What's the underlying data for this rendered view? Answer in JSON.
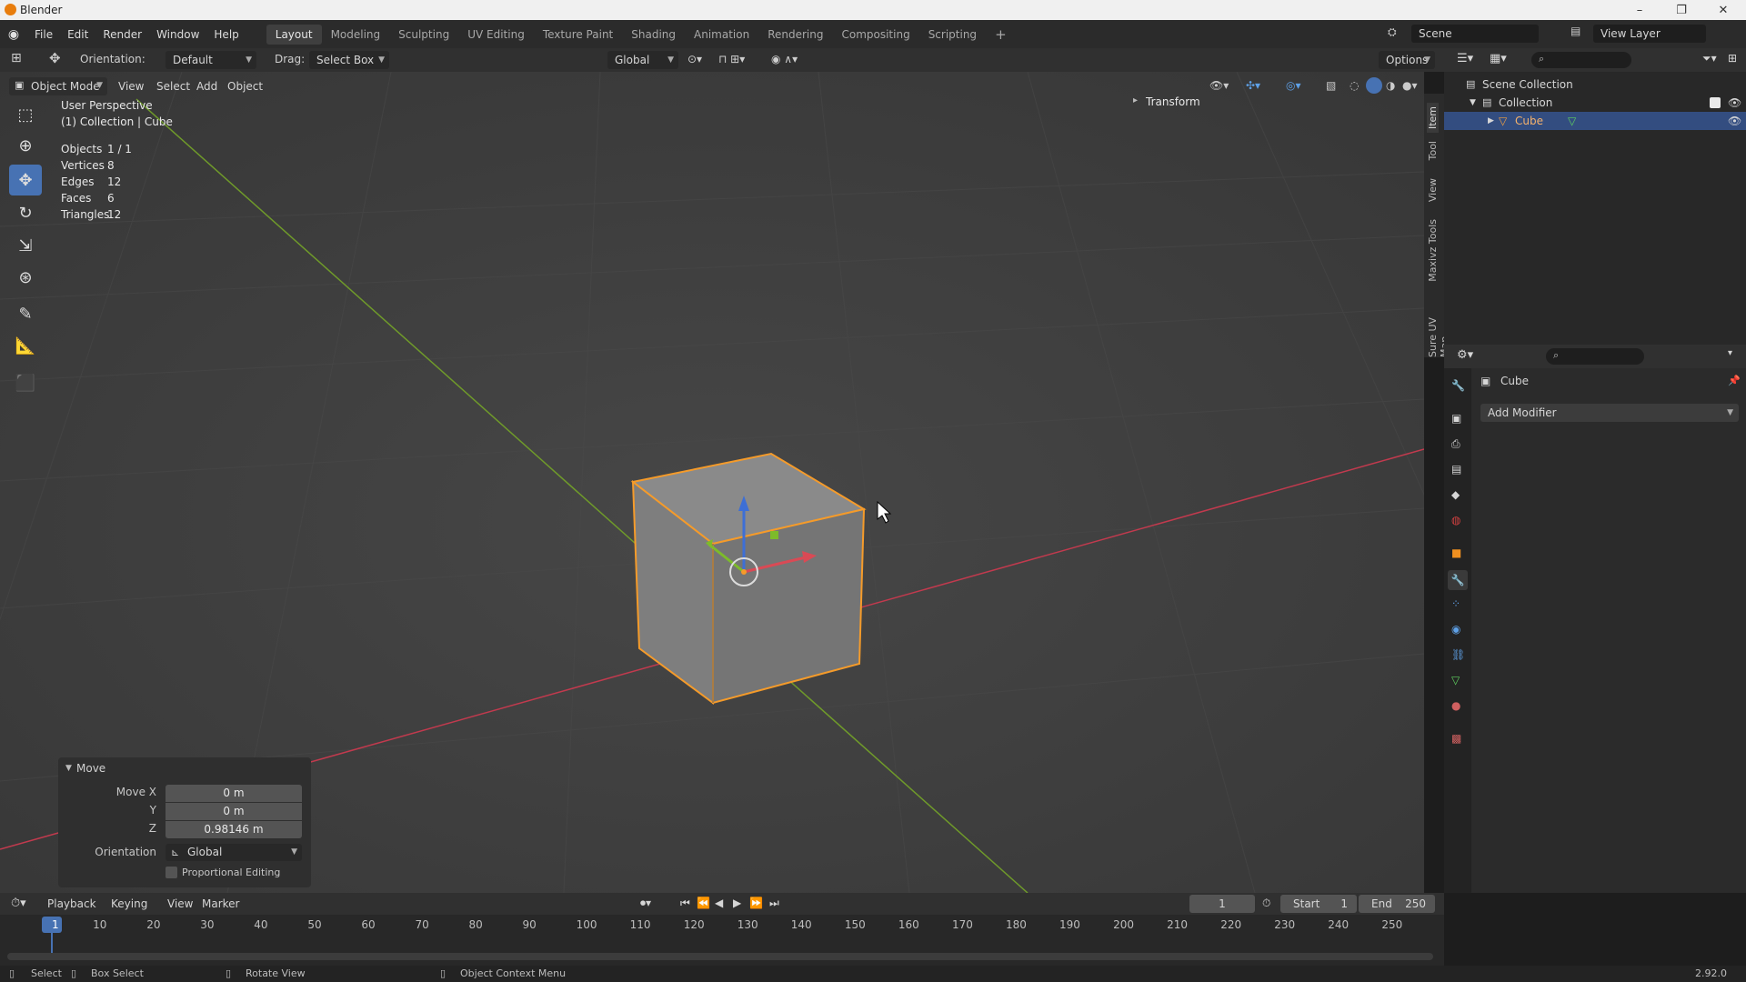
{
  "window": {
    "title": "Blender",
    "minimize": "–",
    "restore": "❐",
    "close": "✕"
  },
  "menu": {
    "items": [
      "File",
      "Edit",
      "Render",
      "Window",
      "Help"
    ]
  },
  "workspaces": [
    "Layout",
    "Modeling",
    "Sculpting",
    "UV Editing",
    "Texture Paint",
    "Shading",
    "Animation",
    "Rendering",
    "Compositing",
    "Scripting"
  ],
  "workspace_add": "+",
  "scene": {
    "label": "Scene",
    "view_layer": "View Layer"
  },
  "tool_header": {
    "orientation_label": "Orientation:",
    "orientation_value": "Default",
    "drag_label": "Drag:",
    "drag_value": "Select Box",
    "transform_orientation": "Global",
    "options": "Options"
  },
  "viewport_header": {
    "mode": "Object Mode",
    "menus": [
      "View",
      "Select",
      "Add",
      "Object"
    ]
  },
  "overlay": {
    "view_name": "User Perspective",
    "collection": "(1) Collection | Cube",
    "stats": [
      {
        "label": "Objects",
        "value": "1 / 1"
      },
      {
        "label": "Vertices",
        "value": "8"
      },
      {
        "label": "Edges",
        "value": "12"
      },
      {
        "label": "Faces",
        "value": "6"
      },
      {
        "label": "Triangles",
        "value": "12"
      }
    ]
  },
  "sidebar": {
    "transform_label": "Transform",
    "tabs": [
      "Item",
      "Tool",
      "View",
      "Maxivz Tools",
      "Sure UV Map"
    ]
  },
  "move_panel": {
    "title": "Move",
    "move_x_label": "Move X",
    "move_x": "0 m",
    "y_label": "Y",
    "move_y": "0 m",
    "z_label": "Z",
    "move_z": "0.98146 m",
    "orientation_label": "Orientation",
    "orientation_value": "Global",
    "proportional": "Proportional Editing"
  },
  "outliner": {
    "scene_collection": "Scene Collection",
    "collection": "Collection",
    "object": "Cube"
  },
  "properties": {
    "object_name": "Cube",
    "add_modifier": "Add Modifier"
  },
  "timeline": {
    "menus": [
      "Playback",
      "Keying",
      "View",
      "Marker"
    ],
    "current_frame": "1",
    "start_label": "Start",
    "start": "1",
    "end_label": "End",
    "end": "250",
    "ticks": [
      "1",
      "10",
      "20",
      "30",
      "40",
      "50",
      "60",
      "70",
      "80",
      "90",
      "100",
      "110",
      "120",
      "130",
      "140",
      "150",
      "160",
      "170",
      "180",
      "190",
      "200",
      "210",
      "220",
      "230",
      "240",
      "250"
    ]
  },
  "statusbar": {
    "select": "Select",
    "box_select": "Box Select",
    "rotate_view": "Rotate View",
    "context_menu": "Object Context Menu",
    "version": "2.92.0"
  },
  "colors": {
    "accent": "#4772b3",
    "selection": "#f59b2a",
    "x_axis": "#c23a4e",
    "y_axis": "#6f9a2a"
  }
}
